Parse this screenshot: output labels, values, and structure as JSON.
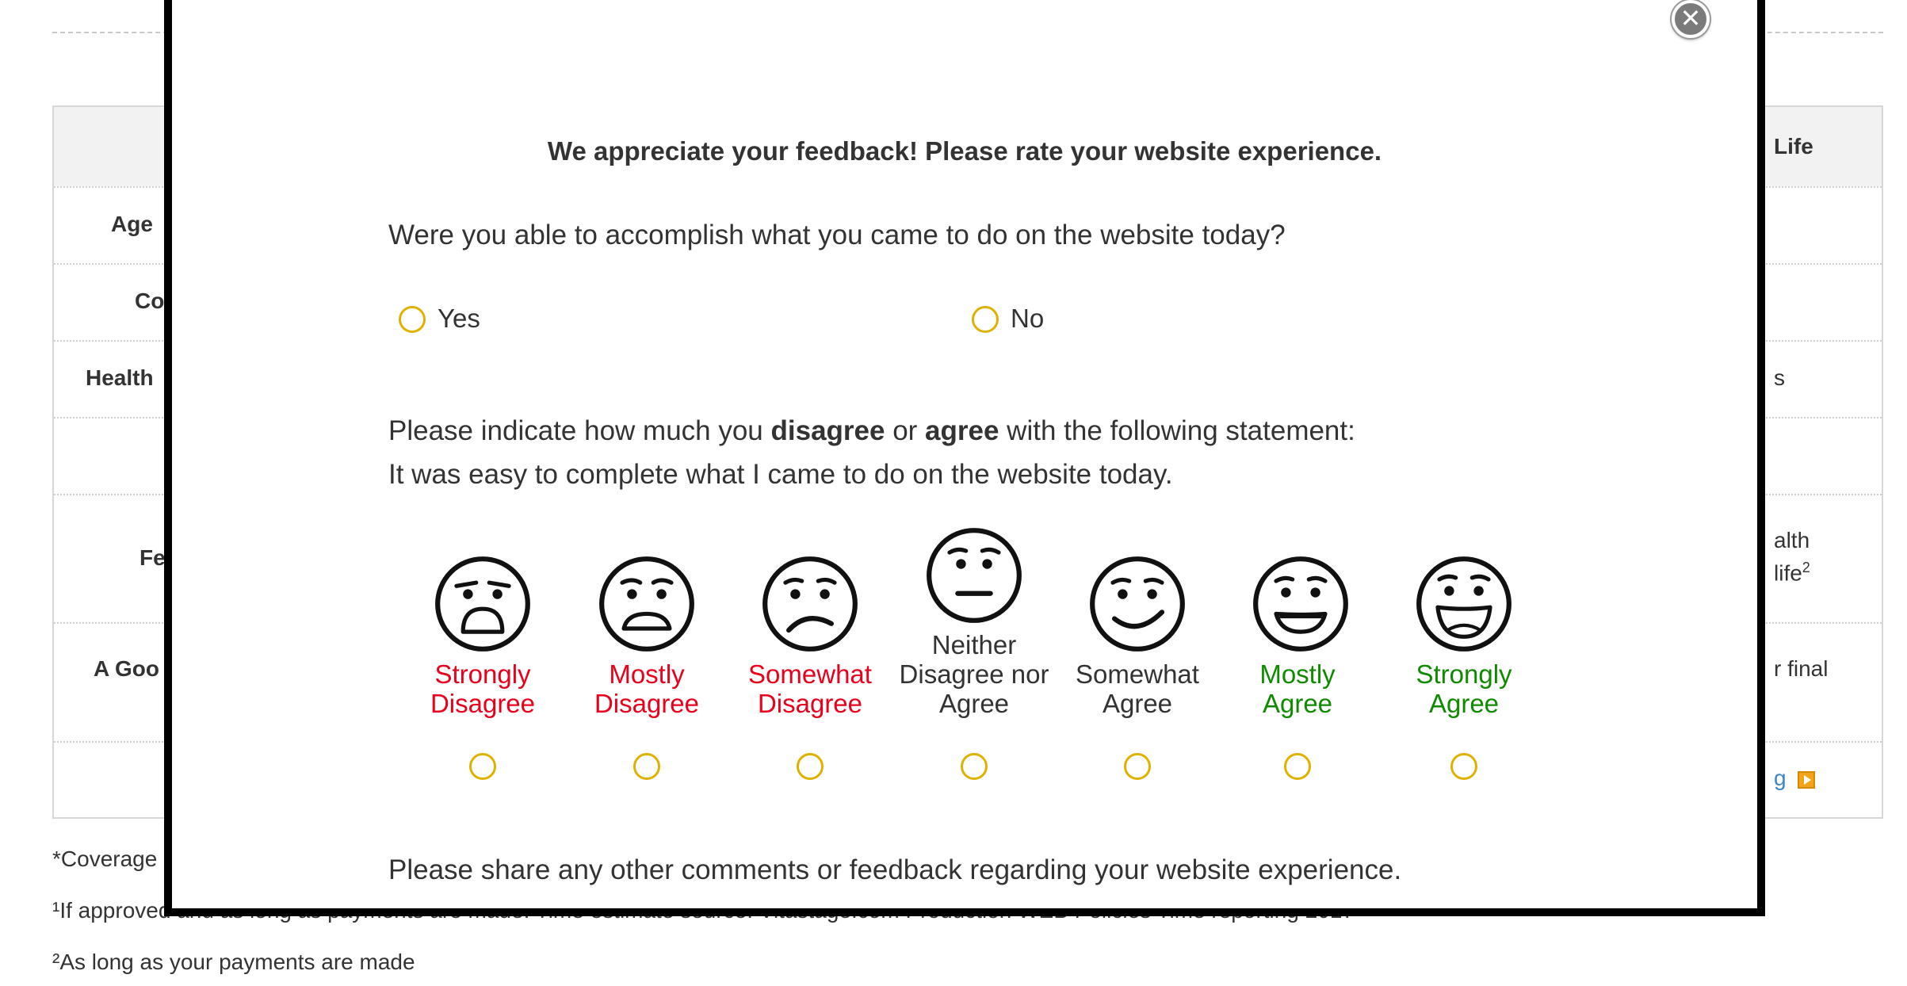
{
  "background": {
    "header_right": "Life",
    "left_labels": [
      "Age",
      "Co",
      "Health",
      "Fe",
      "A Goo"
    ],
    "right_texts": [
      "s",
      "alth",
      "life",
      "2",
      "r final",
      "g"
    ],
    "footnotes": [
      "*Coverage",
      "¹If approved and as long as payments are made. Time estimate source: Vitastage.com Production WEB Policies Time reporting 2017",
      "²As long as your payments are made"
    ]
  },
  "modal": {
    "close_icon": "close-icon",
    "title": "We appreciate your feedback! Please rate your website experience.",
    "question1": "Were you able to accomplish what you came to do on the website today?",
    "q1_options": [
      "Yes",
      "No"
    ],
    "question2": {
      "prefix": "Please indicate how much you ",
      "disagree": "disagree",
      "or": " or ",
      "agree": "agree",
      "suffix": " with the following statement:",
      "statement": "It was easy to complete what I came to do on the website today."
    },
    "scale": [
      {
        "line1": "Strongly",
        "line2": "Disagree",
        "icon": "very-sad-face-icon",
        "color": "#e8001c"
      },
      {
        "line1": "Mostly",
        "line2": "Disagree",
        "icon": "sad-face-icon",
        "color": "#e8001c"
      },
      {
        "line1": "Somewhat",
        "line2": "Disagree",
        "icon": "slightly-sad-face-icon",
        "color": "#e8001c"
      },
      {
        "line0": "Neither",
        "line1": "Disagree nor",
        "line2": "Agree",
        "icon": "neutral-face-icon",
        "color": "#333333"
      },
      {
        "line1": "Somewhat",
        "line2": "Agree",
        "icon": "slightly-smile-face-icon",
        "color": "#333333"
      },
      {
        "line1": "Mostly",
        "line2": "Agree",
        "icon": "smile-face-icon",
        "color": "#108a00"
      },
      {
        "line1": "Strongly",
        "line2": "Agree",
        "icon": "big-smile-face-icon",
        "color": "#108a00"
      }
    ],
    "question3": "Please share any other comments or feedback regarding your website experience."
  }
}
